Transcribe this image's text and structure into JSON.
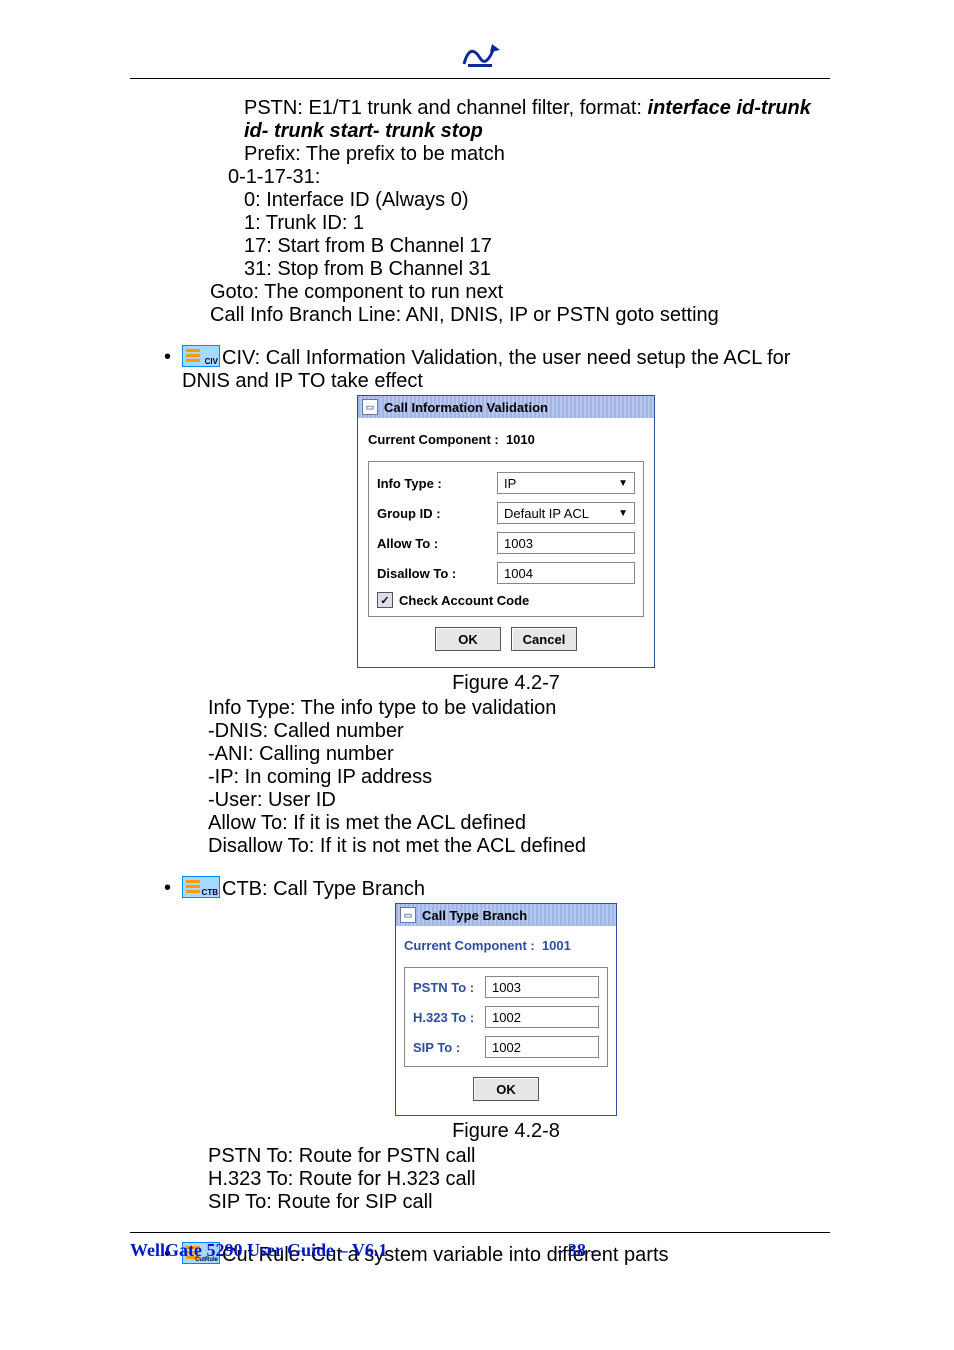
{
  "intro": {
    "pstn_line_prefix": "PSTN: E1/T1 trunk and channel filter, format: ",
    "pstn_format": "interface id-trunk id- trunk start- trunk stop",
    "prefix_line": "Prefix: The prefix to be match",
    "range": "0-1-17-31:",
    "r0": "0: Interface ID (Always 0)",
    "r1": "1: Trunk ID: 1",
    "r17": "17: Start from B Channel 17",
    "r31": "31: Stop from B Channel 31",
    "goto": "Goto: The component to run next",
    "cib": "Call Info Branch Line: ANI, DNIS, IP or PSTN goto setting"
  },
  "civ": {
    "icon_tag": "CIV",
    "heading": "CIV: Call Information Validation, the user need setup the ACL for DNIS and IP TO take effect",
    "dialog": {
      "title": "Call Information Validation",
      "current_label": "Current Component :",
      "current_value": "1010",
      "info_type_label": "Info Type :",
      "info_type_value": "IP",
      "group_label": "Group ID :",
      "group_value": "Default IP ACL",
      "allow_label": "Allow To :",
      "allow_value": "1003",
      "disallow_label": "Disallow To :",
      "disallow_value": "1004",
      "check_label": "Check Account Code",
      "ok": "OK",
      "cancel": "Cancel"
    },
    "caption": "Figure 4.2-7",
    "desc": {
      "l1": "Info Type: The info type to be validation",
      "l2": "-DNIS: Called number",
      "l3": "-ANI: Calling number",
      "l4": "-IP: In coming IP address",
      "l5": "-User: User ID",
      "l6": "Allow To: If it is met the ACL defined",
      "l7": "Disallow To: If it is not met the ACL defined"
    }
  },
  "ctb": {
    "icon_tag": "CTB",
    "heading": "CTB: Call Type Branch",
    "dialog": {
      "title": "Call Type Branch",
      "current_label": "Current Component :",
      "current_value": "1001",
      "pstn_label": "PSTN To :",
      "pstn_value": "1003",
      "h323_label": "H.323 To :",
      "h323_value": "1002",
      "sip_label": "SIP To :",
      "sip_value": "1002",
      "ok": "OK"
    },
    "caption": "Figure 4.2-8",
    "desc": {
      "l1": "PSTN To: Route for PSTN call",
      "l2": "H.323 To: Route for H.323 call",
      "l3": "SIP To: Route for SIP call"
    }
  },
  "cut": {
    "icon_tag": "CutRule",
    "heading": "Cut Rule: Cut a system variable into different parts"
  },
  "footer": {
    "left": "WellGate 5290 User Guide – V6.1",
    "page": "- 38 -"
  }
}
